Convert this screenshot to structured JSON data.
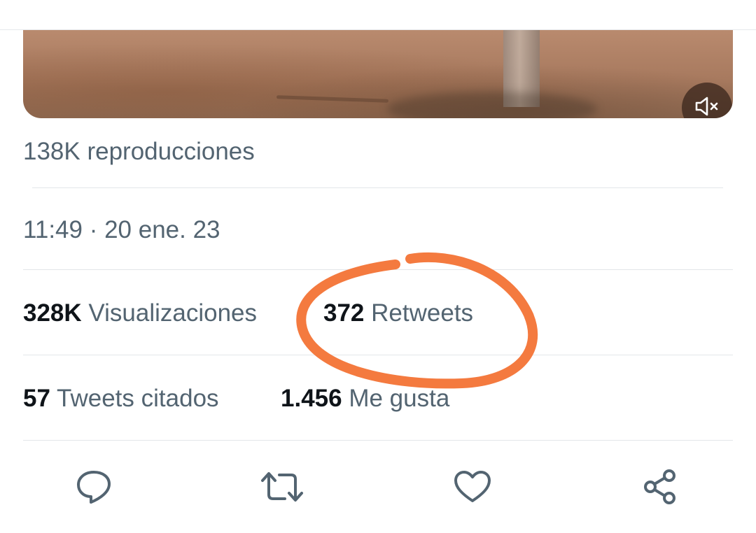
{
  "media": {
    "mute_icon": "speaker-muted-icon"
  },
  "stats": {
    "plays": "138K reproducciones",
    "timestamp": "11:49 · 20 ene. 23",
    "views_count": "328K",
    "views_label": "Visualizaciones",
    "retweets_count": "372",
    "retweets_label": "Retweets",
    "quotes_count": "57",
    "quotes_label": "Tweets citados",
    "likes_count": "1.456",
    "likes_label": "Me gusta"
  },
  "actions": [
    {
      "icon": "reply-icon"
    },
    {
      "icon": "retweet-icon"
    },
    {
      "icon": "like-icon"
    },
    {
      "icon": "share-icon"
    }
  ],
  "colors": {
    "text_primary": "#0f1419",
    "text_secondary": "#536471",
    "divider": "#e3e6e9",
    "annotation": "#f47a3f"
  }
}
